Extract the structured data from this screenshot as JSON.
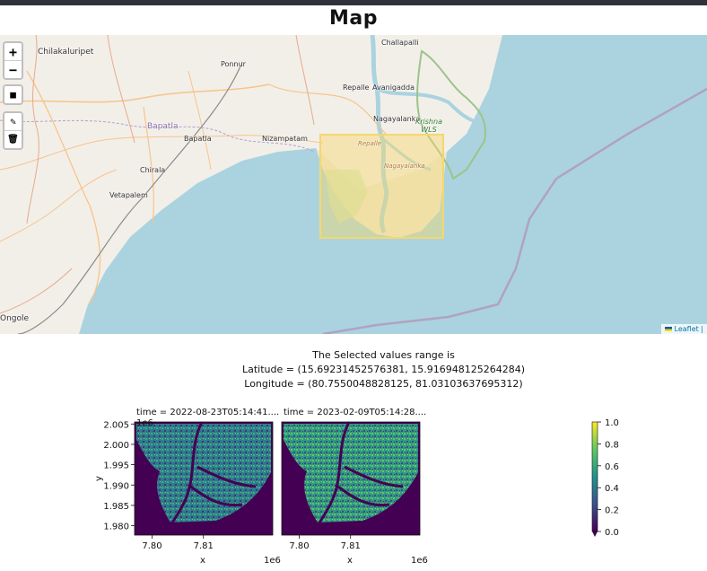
{
  "page": {
    "title": "Map"
  },
  "map": {
    "zoom_in_label": "+",
    "zoom_out_label": "−",
    "draw_rect_label": "■",
    "edit_label": "✎",
    "delete_label": "🗑",
    "places": {
      "chilakaluripet": "Chilakaluripet",
      "challapalli": "Challapalli",
      "ponnur": "Ponnur",
      "repalle": "Repalle",
      "avanigadda": "Avanigadda",
      "nagayalanka": "Nagayalanka",
      "bapatla_district": "Bapatla",
      "bapatla": "Bapatla",
      "nizampatam": "Nizampatam",
      "chirala": "Chirala",
      "vetapalem": "Vetapalem",
      "ongole": "Ongole",
      "krishna_wls_1": "Krishna",
      "krishna_wls_2": "WLS",
      "repalle_forest": "Repalle",
      "nagayalanka_forest": "Nagayalanka"
    },
    "attribution": "Leaflet |",
    "colors": {
      "sea": "#aad3df",
      "land": "#f2efe9",
      "selection": "#f5d76e"
    }
  },
  "selection": {
    "heading": "The Selected values range is",
    "latitude": "Latitude = (15.69231452576381, 15.916948125264284)",
    "longitude": "Longitude = (80.7550048828125, 81.03103637695312)"
  },
  "chart_data": {
    "type": "heatmap",
    "panels": [
      {
        "title": "time = 2022-08-23T05:14:41...."
      },
      {
        "title": "time = 2023-02-09T05:14:28...."
      }
    ],
    "xlabel": "x",
    "ylabel": "y",
    "x_offset_label": "1e6",
    "y_offset_label": "1e6",
    "x_ticks": [
      7.8,
      7.81
    ],
    "x_tick_labels": [
      "7.80",
      "7.81"
    ],
    "y_ticks": [
      1.98,
      1.985,
      1.99,
      1.995,
      2.0,
      2.005
    ],
    "y_tick_labels": [
      "1.980",
      "1.985",
      "1.990",
      "1.995",
      "2.000",
      "2.005"
    ],
    "xlim": [
      7.7966,
      7.8235
    ],
    "ylim": [
      1.9777,
      2.0055
    ],
    "colorbar": {
      "colormap": "viridis",
      "range": [
        0.0,
        1.0
      ],
      "ticks": [
        0.0,
        0.2,
        0.4,
        0.6,
        0.8,
        1.0
      ],
      "tick_labels": [
        "0.0",
        "0.2",
        "0.4",
        "0.6",
        "0.8",
        "1.0"
      ]
    }
  }
}
